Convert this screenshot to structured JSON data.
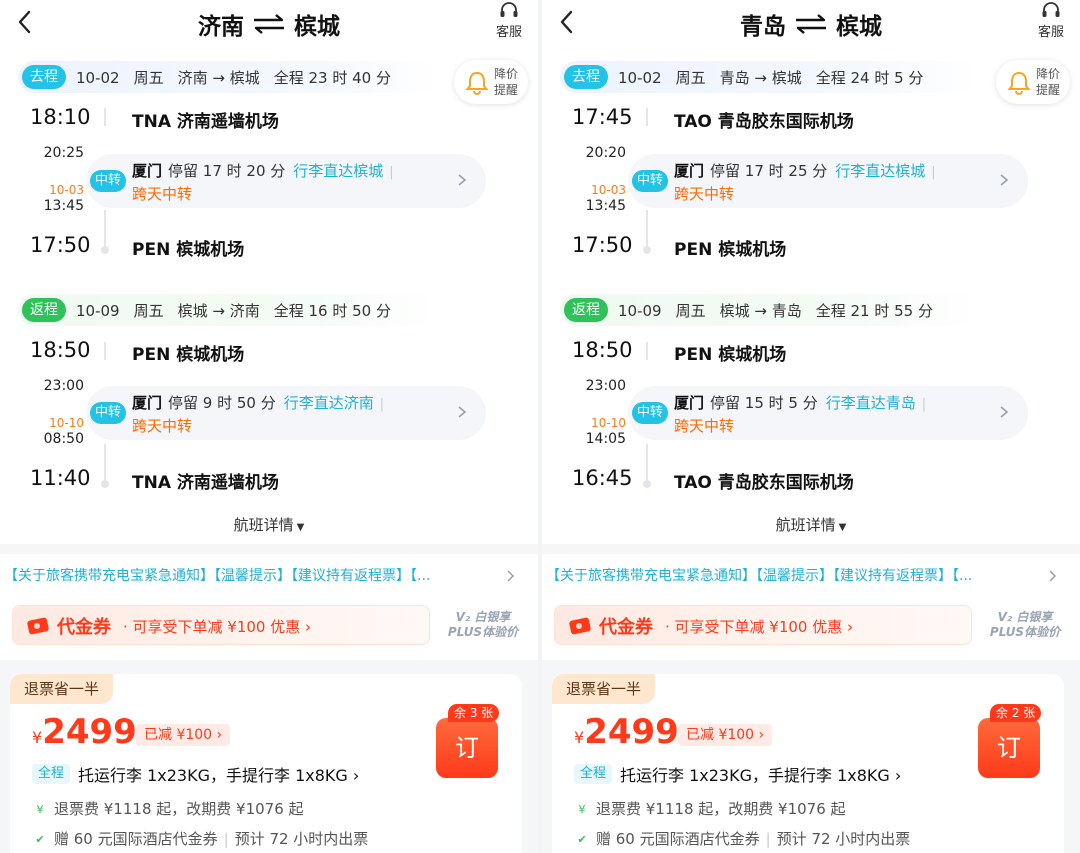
{
  "panels": [
    {
      "header": {
        "from": "济南",
        "to": "槟城",
        "service_label": "客服"
      },
      "price_alert": {
        "line1": "降价",
        "line2": "提醒"
      },
      "outbound": {
        "tag": "去程",
        "date": "10-02",
        "weekday": "周五",
        "route": "济南 → 槟城",
        "duration": "全程 23 时 40 分",
        "dep_time": "18:10",
        "dep_airport": "TNA 济南遥墙机场",
        "leg_arr_time": "20:25",
        "next_day_date": "10-03",
        "leg_dep_time": "13:45",
        "transfer_tag": "中转",
        "transfer_city": "厦门",
        "transfer_stay": "停留 17 时 20 分",
        "transfer_baggage": "行李直达槟城",
        "transfer_note": "跨天中转",
        "arr_time": "17:50",
        "arr_airport": "PEN 槟城机场"
      },
      "return": {
        "tag": "返程",
        "date": "10-09",
        "weekday": "周五",
        "route": "槟城 → 济南",
        "duration": "全程 16 时 50 分",
        "dep_time": "18:50",
        "dep_airport": "PEN 槟城机场",
        "leg_arr_time": "23:00",
        "next_day_date": "10-10",
        "leg_dep_time": "08:50",
        "transfer_tag": "中转",
        "transfer_city": "厦门",
        "transfer_stay": "停留 9 时 50 分",
        "transfer_baggage": "行李直达济南",
        "transfer_note": "跨天中转",
        "arr_time": "11:40",
        "arr_airport": "TNA 济南遥墙机场"
      },
      "details_label": "航班详情",
      "notice": "【关于旅客携带充电宝紧急通知】【温馨提示】【建议持有返程票】【...",
      "voucher": {
        "title": "代金券",
        "subtitle": "· 可享受下单减 ¥100 优惠  ›"
      },
      "plus": {
        "line1": "V₂ 白银享",
        "line2": "PLUS体验价"
      },
      "offer": {
        "refund_tag": "退票省一半",
        "currency": "¥",
        "price": "2499",
        "discount": "已减  ¥100 ›",
        "remaining": "余 3 张",
        "book_label": "订",
        "bag_tag": "全程",
        "baggage": "托运行李 1x23KG，手提行李 1x8KG ›",
        "fees": "退票费 ¥1118 起，改期费 ¥1076 起",
        "gift": "赠 60 元国际酒店代金券",
        "ticketing": "预计 72 小时内出票"
      }
    },
    {
      "header": {
        "from": "青岛",
        "to": "槟城",
        "service_label": "客服"
      },
      "price_alert": {
        "line1": "降价",
        "line2": "提醒"
      },
      "outbound": {
        "tag": "去程",
        "date": "10-02",
        "weekday": "周五",
        "route": "青岛 → 槟城",
        "duration": "全程 24 时 5 分",
        "dep_time": "17:45",
        "dep_airport": "TAO 青岛胶东国际机场",
        "leg_arr_time": "20:20",
        "next_day_date": "10-03",
        "leg_dep_time": "13:45",
        "transfer_tag": "中转",
        "transfer_city": "厦门",
        "transfer_stay": "停留 17 时 25 分",
        "transfer_baggage": "行李直达槟城",
        "transfer_note": "跨天中转",
        "arr_time": "17:50",
        "arr_airport": "PEN 槟城机场"
      },
      "return": {
        "tag": "返程",
        "date": "10-09",
        "weekday": "周五",
        "route": "槟城 → 青岛",
        "duration": "全程 21 时 55 分",
        "dep_time": "18:50",
        "dep_airport": "PEN 槟城机场",
        "leg_arr_time": "23:00",
        "next_day_date": "10-10",
        "leg_dep_time": "14:05",
        "transfer_tag": "中转",
        "transfer_city": "厦门",
        "transfer_stay": "停留 15 时 5 分",
        "transfer_baggage": "行李直达青岛",
        "transfer_note": "跨天中转",
        "arr_time": "16:45",
        "arr_airport": "TAO 青岛胶东国际机场"
      },
      "details_label": "航班详情",
      "notice": "【关于旅客携带充电宝紧急通知】【温馨提示】【建议持有返程票】【...",
      "voucher": {
        "title": "代金券",
        "subtitle": "· 可享受下单减 ¥100 优惠  ›"
      },
      "plus": {
        "line1": "V₂ 白银享",
        "line2": "PLUS体验价"
      },
      "offer": {
        "refund_tag": "退票省一半",
        "currency": "¥",
        "price": "2499",
        "discount": "已减  ¥100 ›",
        "remaining": "余 2 张",
        "book_label": "订",
        "bag_tag": "全程",
        "baggage": "托运行李 1x23KG，手提行李 1x8KG ›",
        "fees": "退票费 ¥1118 起，改期费 ¥1076 起",
        "gift": "赠 60 元国际酒店代金券",
        "ticketing": "预计 72 小时内出票"
      }
    }
  ],
  "colors": {
    "accent_blue": "#22c3e6",
    "return_green": "#2fc25b",
    "price_red": "#ff3a1a",
    "orange": "#ff6a00"
  }
}
